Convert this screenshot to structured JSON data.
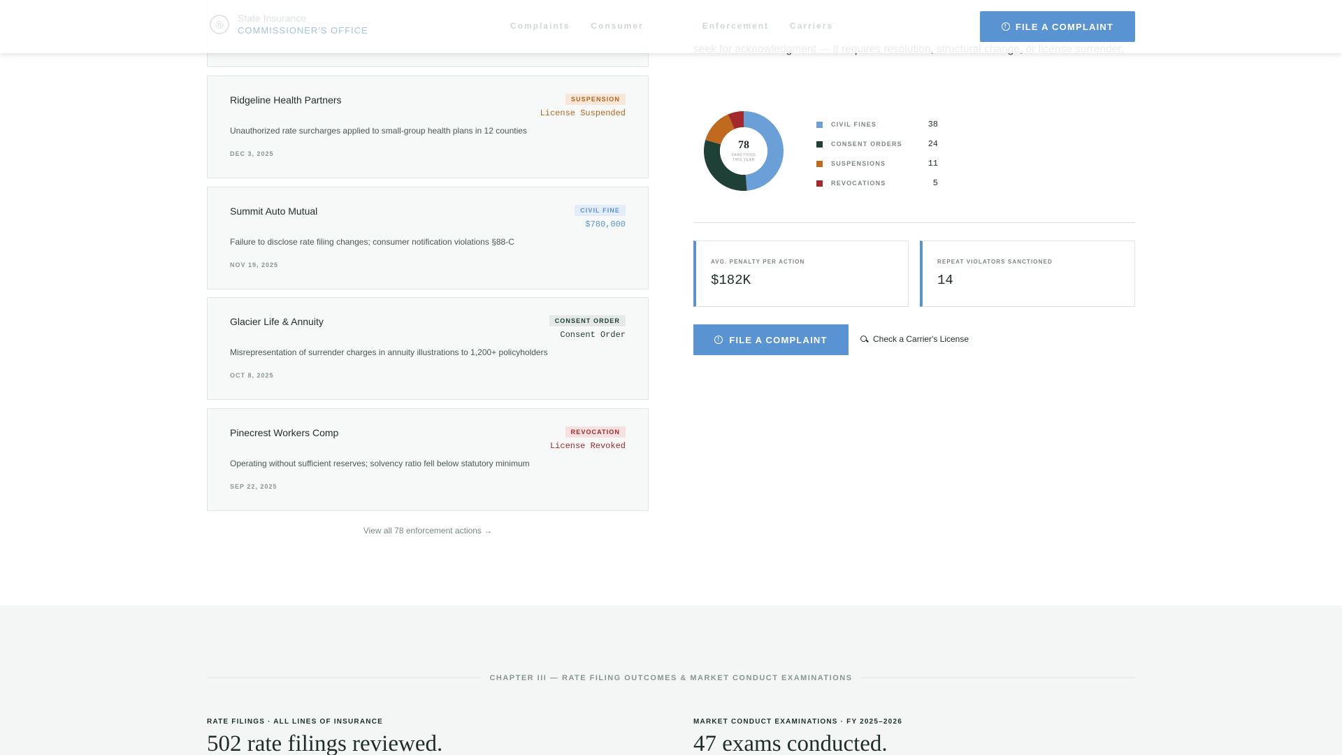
{
  "header": {
    "brand_name": "State Insurance",
    "brand_office": "Commissioner's Office",
    "nav": [
      "Complaints",
      "Consumer",
      "Enforcement",
      "Carriers"
    ],
    "cta_label": "FILE A COMPLAINT"
  },
  "actions": [
    {
      "company": "Ridgeline Health Partners",
      "badge": "Suspension",
      "status": "License Suspended",
      "description": "Unauthorized rate surcharges applied to small-group health plans in 12 counties",
      "date": "DEC 3, 2025",
      "badge_color": "#b5651d",
      "badge_bg": "#f6e7d9"
    },
    {
      "company": "Summit Auto Mutual",
      "badge": "Civil Fine",
      "status": "$780,000",
      "description": "Failure to disclose rate filing changes; consumer notification violations §88-C",
      "date": "NOV 19, 2025",
      "badge_color": "#5a93d2",
      "badge_bg": "#e3edf8"
    },
    {
      "company": "Glacier Life & Annuity",
      "badge": "Consent Order",
      "status": "Consent Order",
      "description": "Misrepresentation of surrender charges in annuity illustrations to 1,200+ policyholders",
      "date": "OCT 8, 2025",
      "badge_color": "#1f3d35",
      "badge_bg": "#e4e9e7"
    },
    {
      "company": "Pinecrest Workers Comp",
      "badge": "Revocation",
      "status": "License Revoked",
      "description": "Operating without sufficient reserves; solvency ratio fell below statutory minimum",
      "date": "SEP 22, 2025",
      "badge_color": "#a3282c",
      "badge_bg": "#f6e1e1"
    }
  ],
  "view_all": "View all 78 enforcement actions →",
  "intro_text": "seek for acknowledgment — it requires resolution, structural change, or license surrender.",
  "chart_data": {
    "type": "pie",
    "center_value": "78",
    "center_label": "SANCTIONS THIS YEAR",
    "categories": [
      "Civil Fines",
      "Consent Orders",
      "Suspensions",
      "Revocations"
    ],
    "values": [
      38,
      24,
      11,
      5
    ],
    "colors": [
      "#6a9fd8",
      "#1f4037",
      "#bf6a1f",
      "#a3282c"
    ]
  },
  "stats": [
    {
      "label": "Avg. Penalty Per Action",
      "value": "$182K"
    },
    {
      "label": "Repeat Violators Sanctioned",
      "value": "14"
    }
  ],
  "cta": {
    "label": "FILE A COMPLAINT",
    "license_link": "Check a Carrier's License"
  },
  "chapter": {
    "title": "Chapter III — Rate Filing Outcomes & Market Conduct Examinations",
    "left": {
      "kicker": "Rate Filings · All Lines of Insurance",
      "heading": "502 rate filings reviewed."
    },
    "right": {
      "kicker": "Market Conduct Examinations · FY 2025–2026",
      "heading": "47 exams conducted."
    }
  }
}
